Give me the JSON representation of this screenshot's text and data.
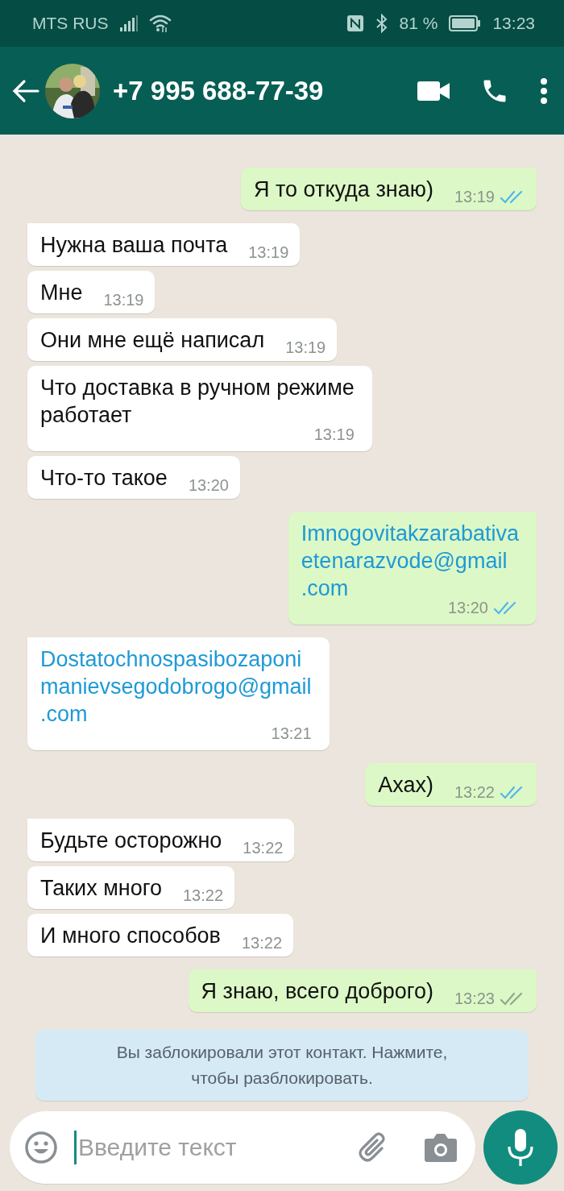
{
  "status_bar": {
    "carrier": "MTS RUS",
    "battery": "81 %",
    "time": "13:23"
  },
  "header": {
    "title": "+7 995 688-77-39"
  },
  "messages": [
    {
      "kind": "out",
      "lines": [
        "Я то откуда знаю)"
      ],
      "time": "13:19",
      "link": false,
      "read": true
    },
    {
      "kind": "in",
      "lines": [
        "Нужна ваша почта"
      ],
      "time": "13:19",
      "link": false
    },
    {
      "kind": "in",
      "lines": [
        "Мне"
      ],
      "time": "13:19",
      "link": false
    },
    {
      "kind": "in",
      "lines": [
        "Они мне ещё написал"
      ],
      "time": "13:19",
      "link": false
    },
    {
      "kind": "in",
      "lines": [
        "Что доставка в ручном режиме",
        "работает"
      ],
      "time": "13:19",
      "link": false
    },
    {
      "kind": "in",
      "lines": [
        "Что-то такое"
      ],
      "time": "13:20",
      "link": false
    },
    {
      "kind": "out",
      "lines": [
        "Imnogovitakzarabativa",
        "etenarazvode@gmail",
        ".com"
      ],
      "time": "13:20",
      "link": true,
      "read": true
    },
    {
      "kind": "in",
      "lines": [
        "Dostatochnospasibozaponi",
        "manievsegodobrogo@gmail",
        ".com"
      ],
      "time": "13:21",
      "link": true
    },
    {
      "kind": "out",
      "lines": [
        "Ахах)"
      ],
      "time": "13:22",
      "link": false,
      "read": true
    },
    {
      "kind": "in",
      "lines": [
        "Будьте осторожно"
      ],
      "time": "13:22",
      "link": false
    },
    {
      "kind": "in",
      "lines": [
        "Таких много"
      ],
      "time": "13:22",
      "link": false
    },
    {
      "kind": "in",
      "lines": [
        "И много способов"
      ],
      "time": "13:22",
      "link": false
    },
    {
      "kind": "out",
      "lines": [
        "Я знаю, всего доброго)"
      ],
      "time": "13:23",
      "link": false,
      "read": false
    }
  ],
  "notice": {
    "lines": [
      "Вы заблокировали этот контакт. Нажмите,",
      "чтобы разблокировать."
    ]
  },
  "composer": {
    "placeholder": "Введите текст"
  }
}
